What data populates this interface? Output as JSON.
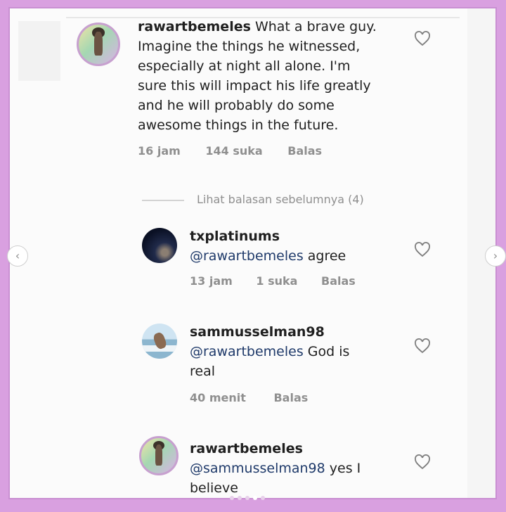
{
  "comments": [
    {
      "user": "rawartbemeles",
      "text_lines": [
        "What a brave guy.",
        "Imagine the things he witnessed,",
        "especially at night all alone. I'm",
        "sure this will impact his life greatly",
        "and he will probably do some",
        "awesome things in the future."
      ],
      "time": "16 jam",
      "likes": "144 suka",
      "reply": "Balas"
    }
  ],
  "view_previous": "Lihat balasan sebelumnya (4)",
  "replies": [
    {
      "user": "txplatinums",
      "mention": "@rawartbemeles",
      "text": " agree",
      "time": "13 jam",
      "likes": "1 suka",
      "reply": "Balas"
    },
    {
      "user": "sammusselman98",
      "mention": "@rawartbemeles",
      "text": " God is",
      "text2": "real",
      "time": "40 menit",
      "reply": "Balas"
    },
    {
      "user": "rawartbemeles",
      "mention": "@sammusselman98",
      "text": " yes I",
      "text2": "believe"
    }
  ],
  "nav": {
    "prev": "‹",
    "next": "›"
  },
  "colors": {
    "frame": "#d9a0e0",
    "mention": "#1f3a6a",
    "meta": "#8f8f8f"
  }
}
